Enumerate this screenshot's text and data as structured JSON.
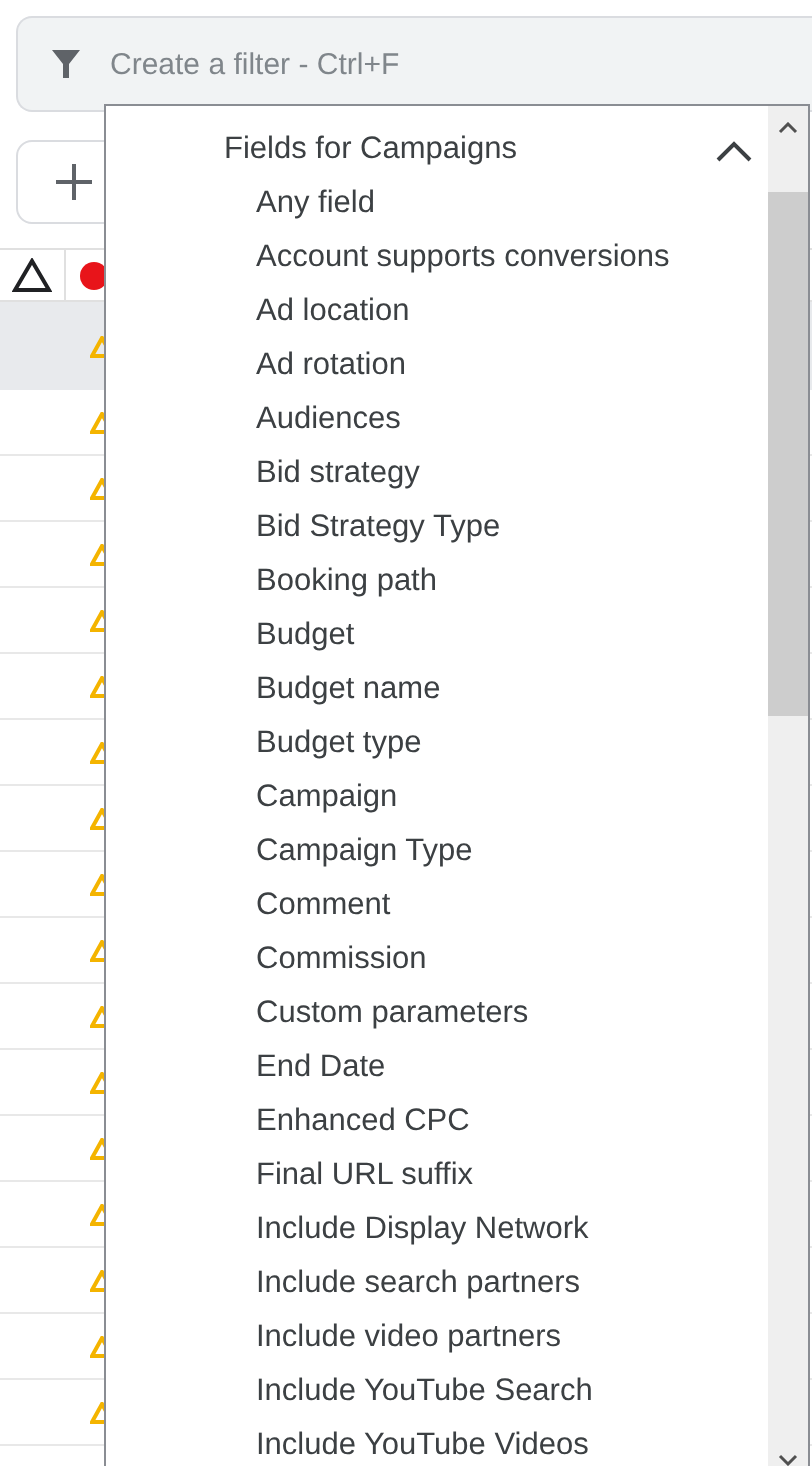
{
  "filter_bar": {
    "placeholder": "Create a filter - Ctrl+F"
  },
  "table": {
    "rows": [
      {
        "selected": true
      },
      {
        "selected": false
      },
      {
        "selected": false
      },
      {
        "selected": false
      },
      {
        "selected": false
      },
      {
        "selected": false
      },
      {
        "selected": false
      },
      {
        "selected": false
      },
      {
        "selected": false
      },
      {
        "selected": false
      },
      {
        "selected": false
      },
      {
        "selected": false
      },
      {
        "selected": false
      },
      {
        "selected": false
      },
      {
        "selected": false
      },
      {
        "selected": false
      },
      {
        "selected": false
      }
    ]
  },
  "dropdown": {
    "group": {
      "title": "Fields for Campaigns",
      "expanded": true,
      "items": [
        "Any field",
        "Account supports conversions",
        "Ad location",
        "Ad rotation",
        "Audiences",
        "Bid strategy",
        "Bid Strategy Type",
        "Booking path",
        "Budget",
        "Budget name",
        "Budget type",
        "Campaign",
        "Campaign Type",
        "Comment",
        "Commission",
        "Custom parameters",
        "End Date",
        "Enhanced CPC",
        "Final URL suffix",
        "Include Display Network",
        "Include search partners",
        "Include video partners",
        "Include YouTube Search",
        "Include YouTube Videos"
      ]
    }
  }
}
